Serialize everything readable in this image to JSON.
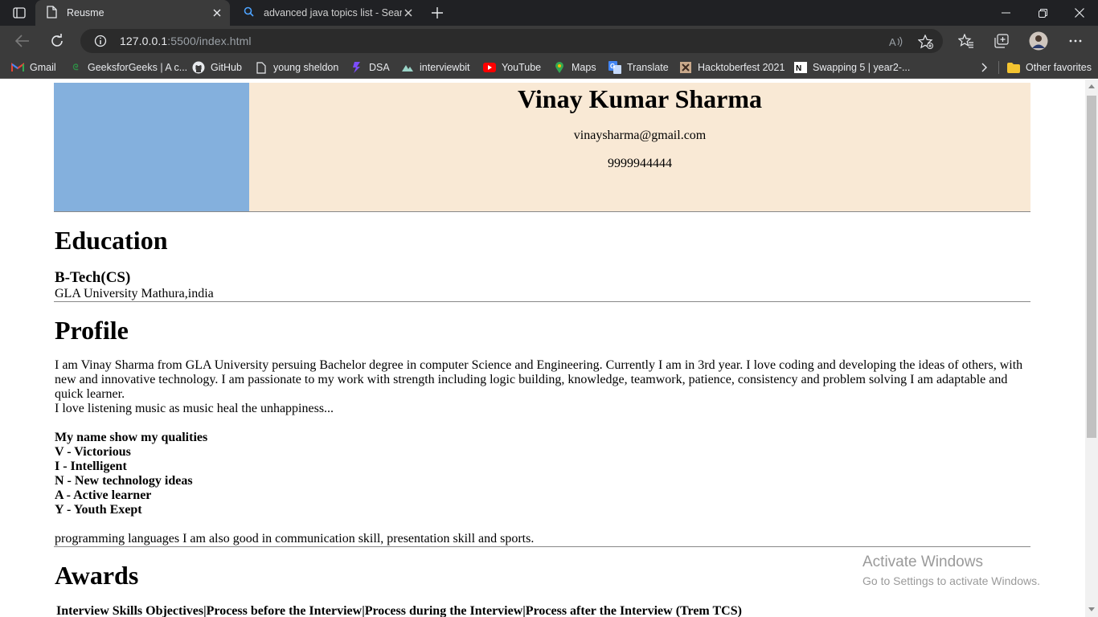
{
  "browser": {
    "tabs": [
      {
        "title": "Reusme",
        "active": true,
        "icon": "page-icon"
      },
      {
        "title": "advanced java topics list - Search",
        "active": false,
        "icon": "search-icon"
      }
    ],
    "url_host": "127.0.0.1",
    "url_rest": ":5500/index.html",
    "bookmarks": [
      {
        "label": "Gmail",
        "icon": "gmail-icon"
      },
      {
        "label": "GeeksforGeeks | A c...",
        "icon": "gfg-icon"
      },
      {
        "label": "GitHub",
        "icon": "github-icon"
      },
      {
        "label": "young sheldon",
        "icon": "page-icon"
      },
      {
        "label": "DSA",
        "icon": "dsa-icon"
      },
      {
        "label": "interviewbit",
        "icon": "interviewbit-icon"
      },
      {
        "label": "YouTube",
        "icon": "youtube-icon"
      },
      {
        "label": "Maps",
        "icon": "maps-icon"
      },
      {
        "label": "Translate",
        "icon": "translate-icon"
      },
      {
        "label": "Hacktoberfest 2021",
        "icon": "hacktoberfest-icon"
      },
      {
        "label": "Swapping 5 | year2-...",
        "icon": "notion-icon"
      }
    ],
    "other_favorites": "Other favorites",
    "colors": {
      "tabstrip": "#202124",
      "toolbar": "#3b3b3b",
      "omnibox": "#2b2b2b"
    }
  },
  "resume": {
    "name": "Vinay Kumar Sharma",
    "email": "vinaysharma@gmail.com",
    "phone": "9999944444",
    "education": {
      "title": "Education",
      "degree": "B-Tech(CS)",
      "university": "GLA University Mathura,india"
    },
    "profile": {
      "title": "Profile",
      "paragraph": "I am Vinay Sharma from GLA University persuing Bachelor degree in computer Science and Engineering. Currently I am in 3rd year. I love coding and developing the ideas of others, with new and innovative technology. I am passionate to my work with strength including logic building, knowledge, teamwork, patience, consistency and problem solving I am adaptable and quick learner.",
      "music": "I love listening music as music heal the unhappiness...",
      "qualities_heading": "My name show my qualities",
      "qualities": [
        "V - Victorious",
        "I - Intelligent",
        "N - New technology ideas",
        "A - Active learner",
        "Y - Youth Exept"
      ],
      "closing": "programming languages I am also good in communication skill, presentation skill and sports."
    },
    "awards": {
      "title": "Awards",
      "first_item": "Interview Skills Objectives|Process before the Interview|Process during the Interview|Process after the Interview (Trem TCS)"
    },
    "colors": {
      "photo_box": "#84b0dd",
      "info_box": "#f9e9d5"
    }
  },
  "watermark": {
    "line1": "Activate Windows",
    "line2": "Go to Settings to activate Windows."
  }
}
